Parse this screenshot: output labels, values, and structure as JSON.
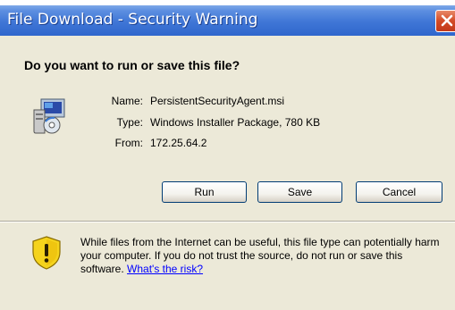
{
  "window": {
    "title": "File Download - Security Warning"
  },
  "dialog": {
    "question": "Do you want to run or save this file?",
    "file_info": [
      {
        "label": "Name:",
        "value": "PersistentSecurityAgent.msi"
      },
      {
        "label": "Type:",
        "value": "Windows Installer Package, 780 KB"
      },
      {
        "label": "From:",
        "value": "172.25.64.2"
      }
    ],
    "buttons": {
      "run": "Run",
      "save": "Save",
      "cancel": "Cancel"
    },
    "warning": {
      "text": "While files from the Internet can be useful, this file type can potentially harm your computer. If you do not trust the source, do not run or save this software.",
      "link": "What's the risk?"
    }
  },
  "icons": {
    "close": "close-icon",
    "file": "installer-file-icon",
    "warning": "warning-shield-icon"
  },
  "colors": {
    "titlebar": "#3f76d6",
    "dialog_bg": "#ece9d8",
    "close_button": "#d24b26",
    "link": "#0000ff",
    "shield_yellow": "#f5d31c"
  }
}
